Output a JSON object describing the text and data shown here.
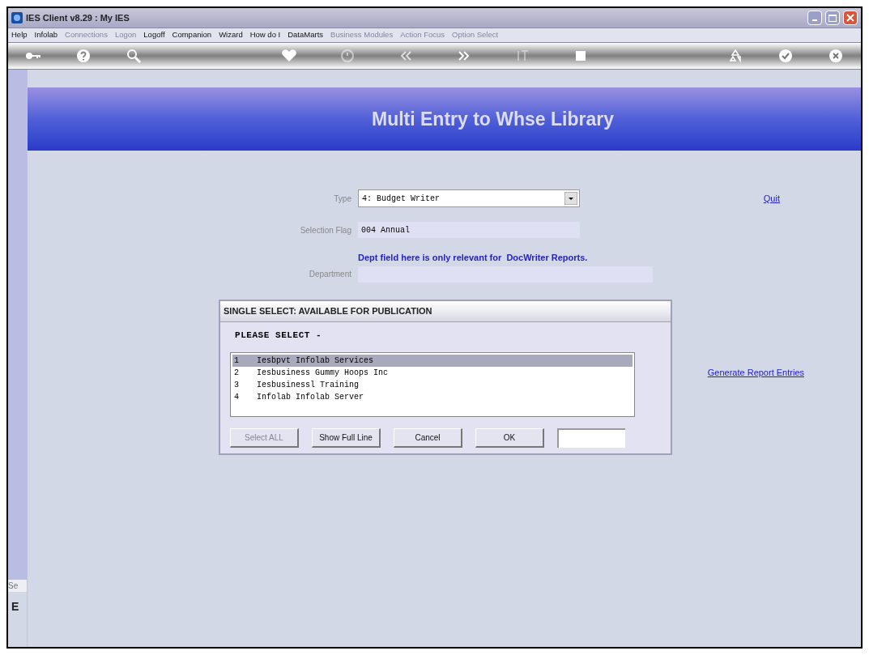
{
  "window": {
    "title": "IES Client v8.29 : My IES"
  },
  "menu": [
    {
      "label": "Help",
      "disabled": false
    },
    {
      "label": "Infolab",
      "disabled": false
    },
    {
      "label": "Connections",
      "disabled": true
    },
    {
      "label": "Logon",
      "disabled": true
    },
    {
      "label": "Logoff",
      "disabled": false
    },
    {
      "label": "Companion",
      "disabled": false
    },
    {
      "label": "Wizard",
      "disabled": false
    },
    {
      "label": "How do I",
      "disabled": false
    },
    {
      "label": "DataMarts",
      "disabled": false
    },
    {
      "label": "Business Modules",
      "disabled": true
    },
    {
      "label": "Action Focus",
      "disabled": true
    },
    {
      "label": "Option Select",
      "disabled": true
    }
  ],
  "sidebar": {
    "label": "Se",
    "icon_text": "E"
  },
  "header": {
    "title": "Multi Entry to Whse Library"
  },
  "form": {
    "type_label": "Type",
    "type_value": "4: Budget Writer",
    "flag_label": "Selection Flag",
    "flag_value": "004 Annual",
    "note": "Dept field here is only relevant for  DocWriter Reports.",
    "dept_label": "Department",
    "quit": "Quit",
    "generate": "Generate Report Entries"
  },
  "dialog": {
    "title": "SINGLE SELECT: AVAILABLE FOR PUBLICATION",
    "prompt": "PLEASE SELECT -",
    "items": [
      {
        "number": "1",
        "text": "Iesbpvt Infolab Services",
        "selected": true
      },
      {
        "number": "2",
        "text": "Iesbusiness Gummy Hoops Inc",
        "selected": false
      },
      {
        "number": "3",
        "text": "Iesbusinessl Training",
        "selected": false
      },
      {
        "number": "4",
        "text": "Infolab Infolab Server",
        "selected": false
      }
    ],
    "buttons": [
      {
        "label": "Select ALL",
        "disabled": true
      },
      {
        "label": "Show Full Line",
        "disabled": false
      },
      {
        "label": "Cancel",
        "disabled": false
      },
      {
        "label": "OK",
        "disabled": false
      }
    ]
  }
}
